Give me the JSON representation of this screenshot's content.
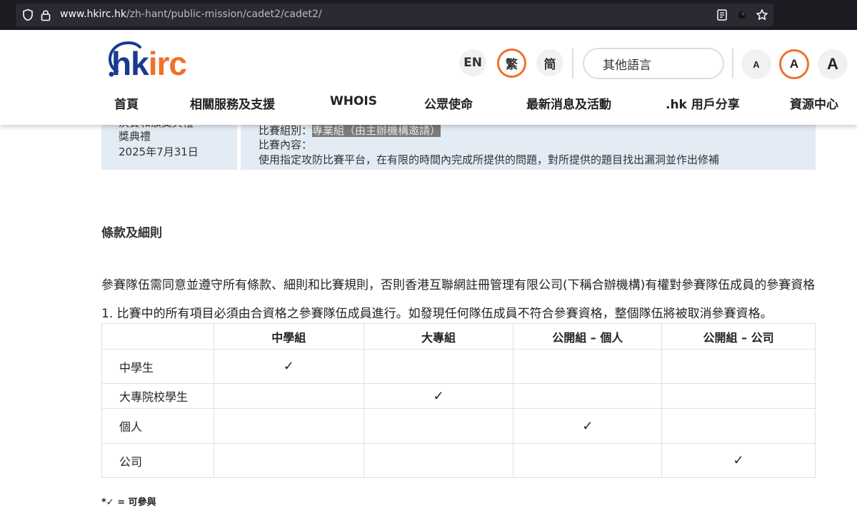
{
  "browser": {
    "url_domain": "www.hkirc.hk",
    "url_path": "/zh-hant/public-mission/cadet2/cadet2/"
  },
  "header": {
    "logo": {
      "dot": ".",
      "hk": "hk",
      "irc": "irc"
    },
    "lang": {
      "en": "EN",
      "trad": "繁",
      "simp": "简"
    },
    "lang_search_placeholder": "其他語言",
    "font_sizes": {
      "small": "A",
      "medium": "A",
      "large": "A"
    },
    "nav": [
      "首頁",
      "相關服務及支援",
      "WHOIS",
      "公眾使命",
      "最新消息及活動",
      ".hk 用戶分享",
      "資源中心"
    ]
  },
  "info": {
    "left_partial": "決賽和頒獎典禮",
    "left_line2": "獎典禮",
    "date": "2025年7月31日",
    "category_label": "比賽組別：",
    "category_value": "專業組（由主辦機構邀請）",
    "content_label": "比賽內容：",
    "content_value": "使用指定攻防比賽平台，在有限的時間內完成所提供的問題，對所提供的題目找出漏洞並作出修補"
  },
  "terms": {
    "title": "條款及細則",
    "intro": "參賽隊伍需同意並遵守所有條款、細則和比賽規則，否則香港互聯網註冊管理有限公司(下稱合辦機構)有權對參賽隊伍成員的參賽資格",
    "rule1": "1. 比賽中的所有項目必須由合資格之參賽隊伍成員進行。如發現任何隊伍成員不符合參賽資格，整個隊伍將被取消參賽資格。"
  },
  "table": {
    "headers": [
      "",
      "中學組",
      "大專組",
      "公開組 – 個人",
      "公開組 – 公司"
    ],
    "rows": [
      {
        "label": "中學生",
        "checks": [
          "✓",
          "",
          "",
          ""
        ]
      },
      {
        "label": "大專院校學生",
        "checks": [
          "",
          "✓",
          "",
          ""
        ]
      },
      {
        "label": "個人",
        "checks": [
          "",
          "",
          "✓",
          ""
        ]
      },
      {
        "label": "公司",
        "checks": [
          "",
          "",
          "",
          "✓"
        ]
      }
    ]
  },
  "footnote": "*✓ = 可參與"
}
